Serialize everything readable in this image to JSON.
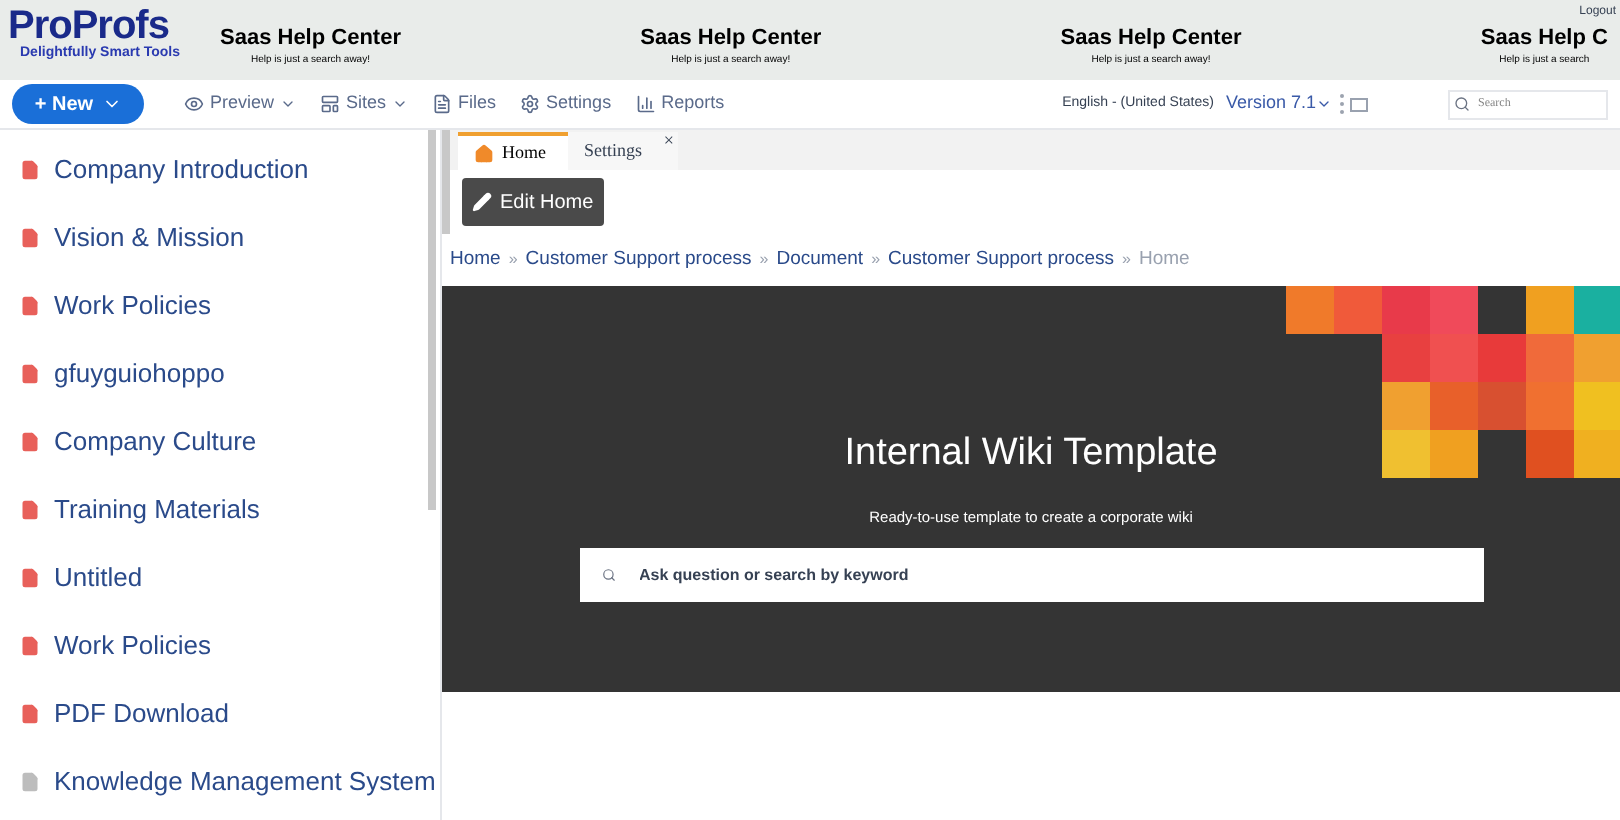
{
  "banner": {
    "logo": "ProProfs",
    "tagline": "Delightfully Smart Tools",
    "tiles": [
      {
        "title": "Saas Help Center",
        "subtitle": "Help is just a search away!"
      },
      {
        "title": "Saas Help Center",
        "subtitle": "Help is just a search away!"
      },
      {
        "title": "Saas Help Center",
        "subtitle": "Help is just a search away!"
      },
      {
        "title": "Saas Help C",
        "subtitle": "Help is just a search"
      }
    ],
    "logout": "Logout"
  },
  "toolbar": {
    "new_button": "+ New",
    "items": [
      {
        "kind": "preview",
        "label": "Preview",
        "dropdown": true
      },
      {
        "kind": "sites",
        "label": "Sites",
        "dropdown": true
      },
      {
        "kind": "files",
        "label": "Files",
        "dropdown": false
      },
      {
        "kind": "settings",
        "label": "Settings",
        "dropdown": false
      },
      {
        "kind": "reports",
        "label": "Reports",
        "dropdown": false
      }
    ],
    "language": "English - (United States)",
    "version": "Version 7.1",
    "search": {
      "placeholder": "Search"
    }
  },
  "sidebar": {
    "items": [
      {
        "label": "Company Introduction",
        "color": "#e8605a"
      },
      {
        "label": "Vision & Mission",
        "color": "#e8605a"
      },
      {
        "label": "Work Policies",
        "color": "#e8605a"
      },
      {
        "label": "gfuyguiohoppo",
        "color": "#e8605a"
      },
      {
        "label": "Company Culture",
        "color": "#e8605a"
      },
      {
        "label": "Training Materials",
        "color": "#e8605a"
      },
      {
        "label": "Untitled",
        "color": "#e8605a"
      },
      {
        "label": "Work Policies",
        "color": "#e8605a"
      },
      {
        "label": "PDF Download",
        "color": "#e8605a"
      },
      {
        "label": "Knowledge Management System",
        "color": "#bdbdbd"
      }
    ]
  },
  "tabs": [
    {
      "label": "Home",
      "selected": true,
      "closable": false
    },
    {
      "label": "Settings",
      "selected": false,
      "closable": true
    }
  ],
  "close_glyph": "×",
  "edit_button": "Edit Home",
  "breadcrumb": [
    {
      "label": "Home",
      "current": false
    },
    {
      "label": "Customer Support process",
      "current": false
    },
    {
      "label": "Document",
      "current": false
    },
    {
      "label": "Customer Support process",
      "current": false
    },
    {
      "label": "Home",
      "current": true
    }
  ],
  "breadcrumb_separator": "»",
  "hero": {
    "title": "Internal Wiki Template",
    "subtitle": "Ready-to-use template to create a corporate wiki",
    "search": {
      "placeholder": "Ask question or search by keyword"
    }
  }
}
